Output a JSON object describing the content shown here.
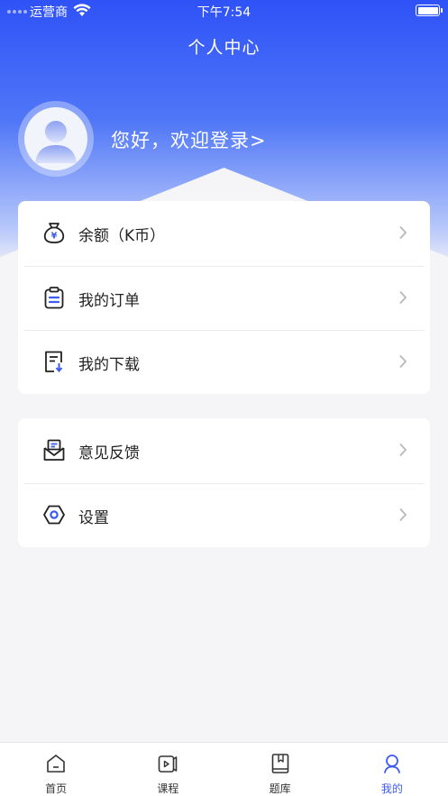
{
  "status_bar": {
    "carrier": "运营商",
    "time": "下午7:54"
  },
  "header": {
    "title": "个人中心",
    "login_prompt": "您好，欢迎登录>"
  },
  "menu_group_1": [
    {
      "label": "余额（K币）",
      "icon": "money-bag-icon"
    },
    {
      "label": "我的订单",
      "icon": "clipboard-icon"
    },
    {
      "label": "我的下载",
      "icon": "download-doc-icon"
    }
  ],
  "menu_group_2": [
    {
      "label": "意见反馈",
      "icon": "feedback-mail-icon"
    },
    {
      "label": "设置",
      "icon": "settings-hexagon-icon"
    }
  ],
  "tabbar": [
    {
      "label": "首页",
      "icon": "home-icon",
      "active": false
    },
    {
      "label": "课程",
      "icon": "course-video-icon",
      "active": false
    },
    {
      "label": "题库",
      "icon": "question-bank-icon",
      "active": false
    },
    {
      "label": "我的",
      "icon": "profile-icon",
      "active": true
    }
  ],
  "colors": {
    "brand": "#2f52f7",
    "active_tab": "#3d5af1",
    "icon_accent": "#3d5af1"
  }
}
